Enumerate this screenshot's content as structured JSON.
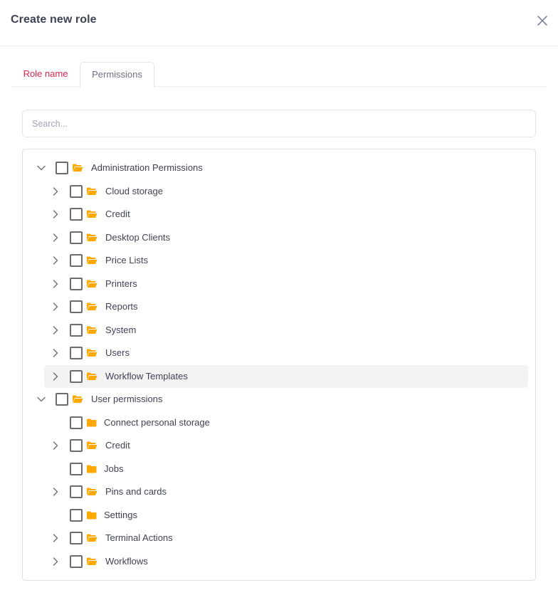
{
  "dialog": {
    "title": "Create new role",
    "close_icon": "close-icon"
  },
  "tabs": [
    {
      "label": "Role name",
      "active": false,
      "color": "#e4254b"
    },
    {
      "label": "Permissions",
      "active": true
    }
  ],
  "search": {
    "placeholder": "Search...",
    "value": ""
  },
  "colors": {
    "accent": "#e4254b",
    "folder": "#ffa800",
    "highlight_row": "#f3f3f3"
  },
  "tree": [
    {
      "label": "Administration Permissions",
      "level": 0,
      "expanded": true,
      "has_children": true,
      "checked": false,
      "icon": "folder-open-icon"
    },
    {
      "label": "Cloud storage",
      "level": 1,
      "expanded": false,
      "has_children": true,
      "checked": false,
      "icon": "folder-open-icon"
    },
    {
      "label": "Credit",
      "level": 1,
      "expanded": false,
      "has_children": true,
      "checked": false,
      "icon": "folder-open-icon"
    },
    {
      "label": "Desktop Clients",
      "level": 1,
      "expanded": false,
      "has_children": true,
      "checked": false,
      "icon": "folder-open-icon"
    },
    {
      "label": "Price Lists",
      "level": 1,
      "expanded": false,
      "has_children": true,
      "checked": false,
      "icon": "folder-open-icon"
    },
    {
      "label": "Printers",
      "level": 1,
      "expanded": false,
      "has_children": true,
      "checked": false,
      "icon": "folder-open-icon"
    },
    {
      "label": "Reports",
      "level": 1,
      "expanded": false,
      "has_children": true,
      "checked": false,
      "icon": "folder-open-icon"
    },
    {
      "label": "System",
      "level": 1,
      "expanded": false,
      "has_children": true,
      "checked": false,
      "icon": "folder-open-icon"
    },
    {
      "label": "Users",
      "level": 1,
      "expanded": false,
      "has_children": true,
      "checked": false,
      "icon": "folder-open-icon"
    },
    {
      "label": "Workflow Templates",
      "level": 1,
      "expanded": false,
      "has_children": true,
      "checked": false,
      "icon": "folder-open-icon",
      "highlighted": true
    },
    {
      "label": "User permissions",
      "level": 0,
      "expanded": true,
      "has_children": true,
      "checked": false,
      "icon": "folder-open-icon"
    },
    {
      "label": "Connect personal storage",
      "level": 1,
      "has_children": false,
      "checked": false,
      "icon": "folder-icon"
    },
    {
      "label": "Credit",
      "level": 1,
      "expanded": false,
      "has_children": true,
      "checked": false,
      "icon": "folder-open-icon"
    },
    {
      "label": "Jobs",
      "level": 1,
      "has_children": false,
      "checked": false,
      "icon": "folder-icon"
    },
    {
      "label": "Pins and cards",
      "level": 1,
      "expanded": false,
      "has_children": true,
      "checked": false,
      "icon": "folder-open-icon"
    },
    {
      "label": "Settings",
      "level": 1,
      "has_children": false,
      "checked": false,
      "icon": "folder-icon"
    },
    {
      "label": "Terminal Actions",
      "level": 1,
      "expanded": false,
      "has_children": true,
      "checked": false,
      "icon": "folder-open-icon"
    },
    {
      "label": "Workflows",
      "level": 1,
      "expanded": false,
      "has_children": true,
      "checked": false,
      "icon": "folder-open-icon"
    }
  ]
}
